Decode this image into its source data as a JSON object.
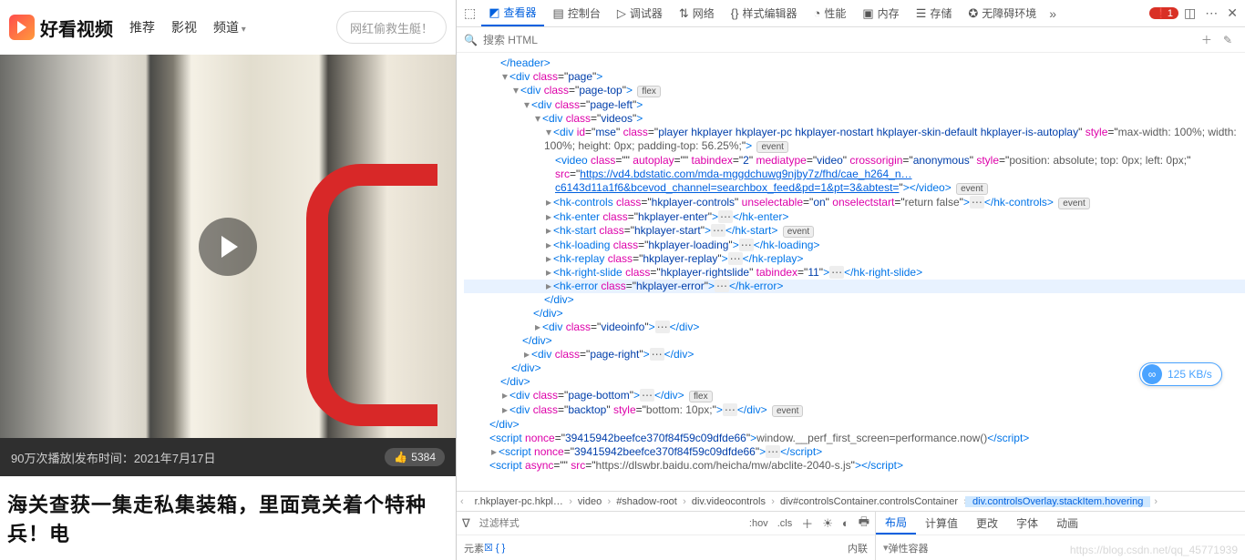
{
  "hk": {
    "brand": "好看视频",
    "nav": [
      "推荐",
      "影视",
      "频道"
    ],
    "search_placeholder": "网红偷救生艇！",
    "plays": "90万次播放",
    "sep": " | ",
    "pub_label": "发布时间：",
    "pub_time": "2021年7月17日",
    "likes": "5384",
    "title": "海关查获一集走私集装箱，里面竟关着个特种兵！电"
  },
  "dt": {
    "tabs": [
      "查看器",
      "控制台",
      "调试器",
      "网络",
      "样式编辑器",
      "性能",
      "内存",
      "存储",
      "无障碍环境"
    ],
    "error_count": "1",
    "search_placeholder": "搜索 HTML",
    "badges": {
      "flex": "flex",
      "event": "event"
    },
    "tree": {
      "l0": "</header>",
      "l1": {
        "cls": "page"
      },
      "l2": {
        "cls": "page-top"
      },
      "l3": {
        "cls": "page-left"
      },
      "l4": {
        "cls": "videos"
      },
      "l5": {
        "id": "mse",
        "cls": "player hkplayer hkplayer-pc hkplayer-nostart hkplayer-skin-default hkplayer-is-autoplay",
        "style": "max-width: 100%; width: 100%; height: 0px; padding-top: 56.25%;"
      },
      "l6": {
        "tag": "video",
        "cls": "",
        "autoplay": "",
        "tabindex": "2",
        "mediatype": "video",
        "crossorigin": "anonymous",
        "style": "position: absolute; top: 0px; left: 0px;",
        "src": "https://vd4.bdstatic.com/mda-mggdchuwg9njby7z/fhd/cae_h264_n…c6143d11a1f6&bcevod_channel=searchbox_feed&pd=1&pt=3&abtest="
      },
      "l7": {
        "tag": "hk-controls",
        "cls": "hkplayer-controls",
        "unsel": "on",
        "onsel": "return false",
        "close": "</hk-controls>"
      },
      "l8": {
        "tag": "hk-enter",
        "cls": "hkplayer-enter",
        "close": "</hk-enter>"
      },
      "l9": {
        "tag": "hk-start",
        "cls": "hkplayer-start",
        "close": "</hk-start>"
      },
      "l10": {
        "tag": "hk-loading",
        "cls": "hkplayer-loading",
        "close": "</hk-loading>"
      },
      "l11": {
        "tag": "hk-replay",
        "cls": "hkplayer-replay",
        "close": "</hk-replay>"
      },
      "l12": {
        "tag": "hk-right-slide",
        "cls": "hkplayer-rightslide",
        "tabindex": "11",
        "close": "</hk-right-slide>"
      },
      "l13": {
        "tag": "hk-error",
        "cls": "hkplayer-error",
        "close": "</hk-error>"
      },
      "l14": "</div>",
      "l15": "</div>",
      "l16": {
        "cls": "videoinfo",
        "close": "</div>"
      },
      "l17": "</div>",
      "l18": {
        "cls": "page-right",
        "close": "</div>"
      },
      "l19": "</div>",
      "l20": "</div>",
      "l21": {
        "cls": "page-bottom",
        "close": "</div>"
      },
      "l22": {
        "cls": "backtop",
        "style": "bottom: 10px;",
        "close": "</div>"
      },
      "l23": "</div>",
      "l24": {
        "nonce": "39415942beefce370f84f59c09dfde66",
        "body": "window.__perf_first_screen=performance.now()",
        "close": "</script"
      },
      "l25": {
        "nonce": "39415942beefce370f84f59c09dfde66",
        "close": "</script"
      },
      "l26": {
        "async": "",
        "src": "https://dlswbr.baidu.com/heicha/mw/abclite-2040-s.js",
        "close": "</script"
      }
    },
    "crumbs": [
      "r.hkplayer-pc.hkpl…",
      "video",
      "#shadow-root",
      "div.videocontrols",
      "div#controlsContainer.controlsContainer",
      "div.controlsOverlay.stackItem.hovering"
    ],
    "filter_ph": "过滤样式",
    "hov": ":hov",
    "cls": ".cls",
    "left_tab1": "元素",
    "left_val": "内联",
    "rtabs": [
      "布局",
      "计算值",
      "更改",
      "字体",
      "动画"
    ],
    "rsec": "弹性容器"
  },
  "pill": "125 KB/s",
  "watermark": "https://blog.csdn.net/qq_45771939"
}
